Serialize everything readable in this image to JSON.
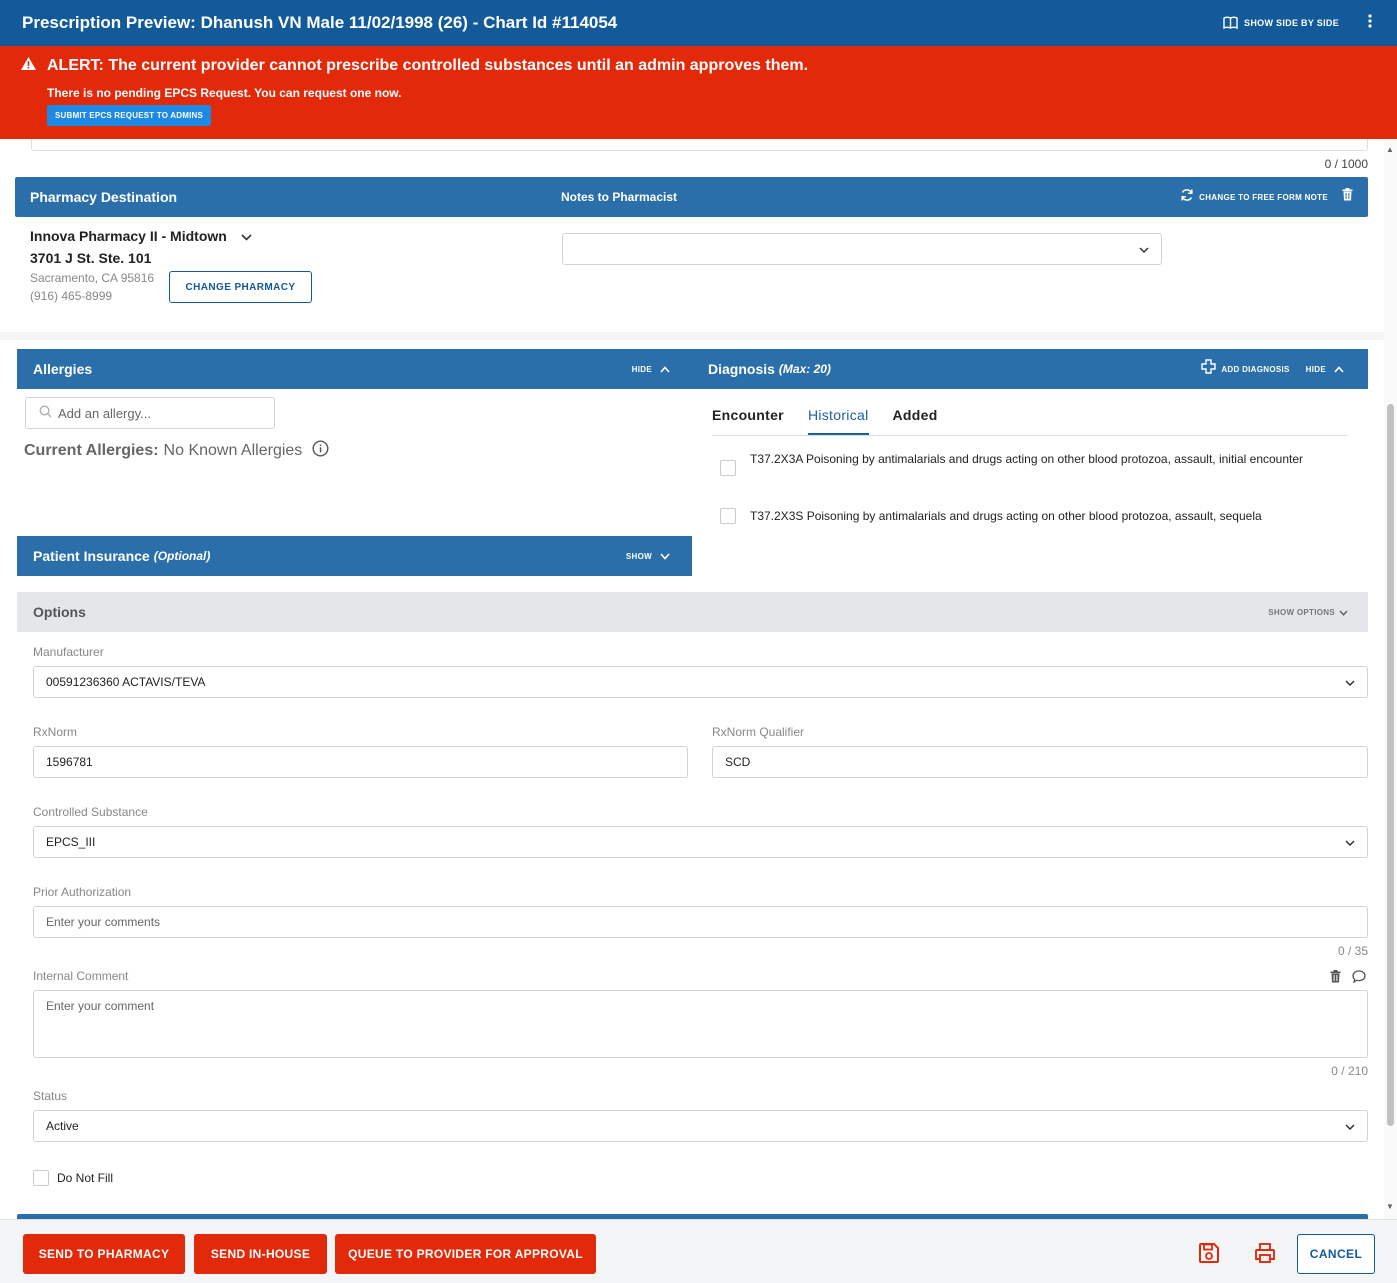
{
  "header": {
    "title": "Prescription Preview: Dhanush VN Male 11/02/1998 (26) - Chart Id #114054",
    "show_side_by_side": "SHOW SIDE BY SIDE",
    "menu_icon": "kebab-icon"
  },
  "alert": {
    "title": "ALERT: The current provider cannot prescribe controlled substances until an admin approves them.",
    "message": "There is no pending EPCS Request. You can request one now.",
    "button": "SUBMIT EPCS REQUEST TO ADMINS"
  },
  "top_counter": "0 / 1000",
  "pharmacy": {
    "section_title": "Pharmacy Destination",
    "notes_title": "Notes to Pharmacist",
    "change_free_form": "CHANGE TO FREE FORM NOTE",
    "name": "Innova Pharmacy II - Midtown",
    "address": "3701 J St. Ste. 101",
    "city": "Sacramento, CA 95816",
    "phone": "(916) 465-8999",
    "change_button": "CHANGE PHARMACY",
    "notes_value": ""
  },
  "allergies": {
    "title": "Allergies",
    "hide": "HIDE",
    "search_placeholder": "Add an allergy...",
    "current_label": "Current Allergies:",
    "current_value": "No Known Allergies"
  },
  "diagnosis": {
    "title": "Diagnosis",
    "max": "(Max: 20)",
    "add": "ADD DIAGNOSIS",
    "hide": "HIDE",
    "tabs": [
      "Encounter",
      "Historical",
      "Added"
    ],
    "active_tab": "Historical",
    "items": [
      {
        "text": "T37.2X3A Poisoning by antimalarials and drugs acting on other blood protozoa, assault, initial encounter",
        "checked": false
      },
      {
        "text": "T37.2X3S Poisoning by antimalarials and drugs acting on other blood protozoa, assault, sequela",
        "checked": false
      }
    ]
  },
  "insurance": {
    "title": "Patient Insurance",
    "optional": "(Optional)",
    "show": "SHOW"
  },
  "options": {
    "title": "Options",
    "show_options": "SHOW OPTIONS",
    "manufacturer_label": "Manufacturer",
    "manufacturer_value": "00591236360 ACTAVIS/TEVA",
    "rxnorm_label": "RxNorm",
    "rxnorm_value": "1596781",
    "rxnorm_qualifier_label": "RxNorm Qualifier",
    "rxnorm_qualifier_value": "SCD",
    "controlled_label": "Controlled Substance",
    "controlled_value": "EPCS_III",
    "prior_auth_label": "Prior Authorization",
    "prior_auth_placeholder": "Enter your comments",
    "prior_auth_counter": "0 / 35",
    "internal_comment_label": "Internal Comment",
    "internal_comment_placeholder": "Enter your comment",
    "internal_comment_counter": "0 / 210",
    "status_label": "Status",
    "status_value": "Active",
    "do_not_fill": "Do Not Fill"
  },
  "footer": {
    "send_pharmacy": "SEND TO PHARMACY",
    "send_inhouse": "SEND IN-HOUSE",
    "queue": "QUEUE TO PROVIDER FOR APPROVAL",
    "cancel": "CANCEL"
  },
  "colors": {
    "header_blue": "#135a9a",
    "section_blue": "#2a6fa9",
    "alert_red": "#e22a0a",
    "link_blue": "#1a5f9e"
  }
}
